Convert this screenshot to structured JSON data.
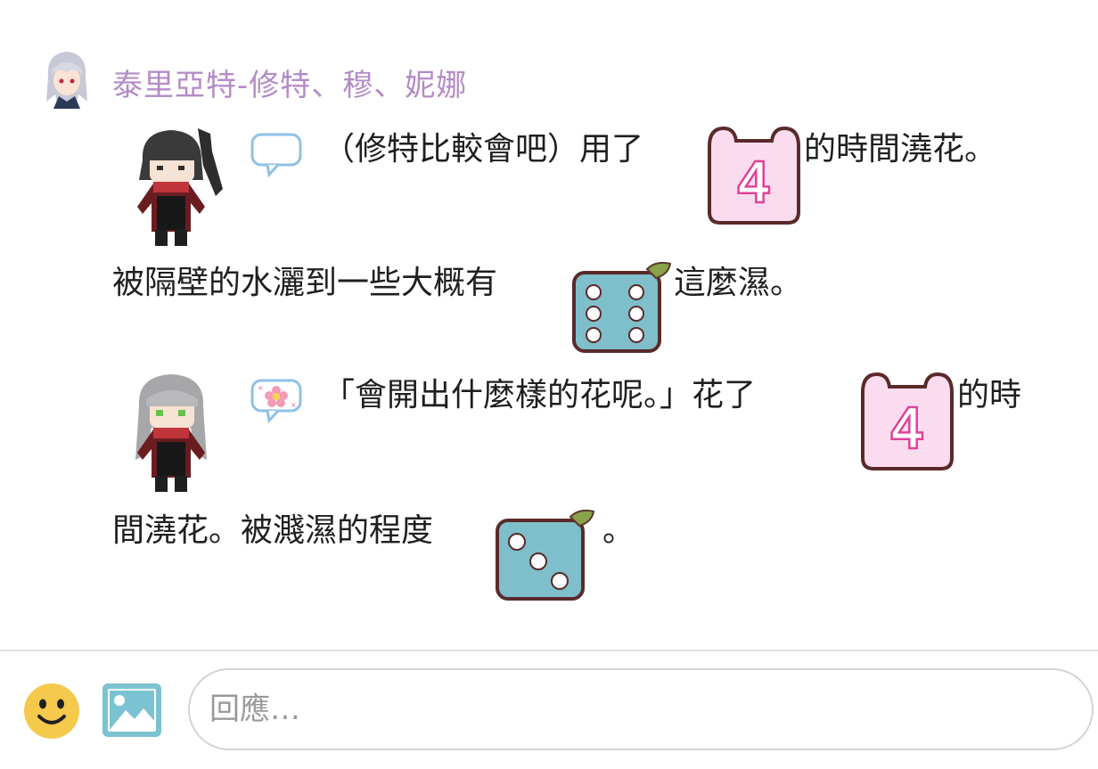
{
  "post": {
    "author": "泰里亞特-修特、穆、妮娜",
    "lines": [
      "（修特比較會吧）用了",
      "的時間澆花。",
      "被隔壁的水灑到一些大概有",
      "這麼濕。",
      "「會開出什麼樣的花呢。」花了",
      "的時",
      "間澆花。被濺濕的程度",
      "。"
    ],
    "dice": [
      {
        "type": "calendar",
        "value": "4"
      },
      {
        "type": "die",
        "value": 6
      },
      {
        "type": "calendar",
        "value": "4"
      },
      {
        "type": "die",
        "value": 3
      }
    ]
  },
  "icons": {
    "author_avatar": "avatar-icon",
    "sprite_1": "dark-hair-chibi-sprite",
    "sprite_2": "silver-hair-chibi-sprite",
    "bubble_1": "speech-bubble-icon",
    "bubble_2": "flower-bubble-icon",
    "emoji": "smiley-icon",
    "image": "image-icon"
  },
  "composer": {
    "placeholder": "回應…"
  },
  "colors": {
    "author": "#b38bc6",
    "calendar_fill": "#fbdcef",
    "calendar_accent": "#e0409a",
    "die_fill": "#7fbecb",
    "border_dark": "#5a2a2a",
    "smiley": "#f4c94c",
    "image_icon": "#7bc3d3"
  }
}
